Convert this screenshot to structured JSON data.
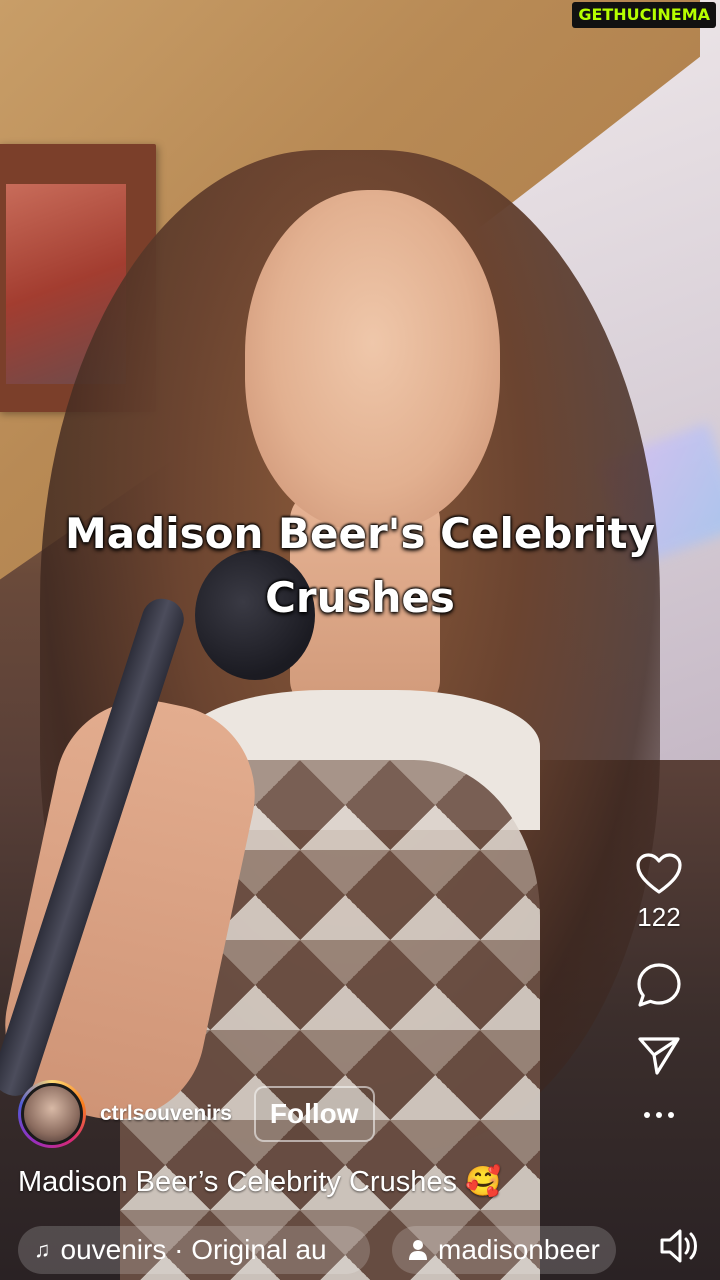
{
  "watermark": "GETHUCINEMA",
  "overlay_title": "Madison Beer's Celebrity\nCrushes",
  "actions": {
    "like_count": "122"
  },
  "author": {
    "username": "ctrlsouvenirs",
    "follow_label": "Follow"
  },
  "caption": "Madison Beer’s Celebrity Crushes 🥰",
  "audio": {
    "label": "ouvenirs · Original au"
  },
  "tagged_user": "madisonbeer",
  "icons": [
    "heart-icon",
    "comment-icon",
    "share-icon",
    "more-icon",
    "music-note-icon",
    "person-icon",
    "speaker-icon"
  ]
}
